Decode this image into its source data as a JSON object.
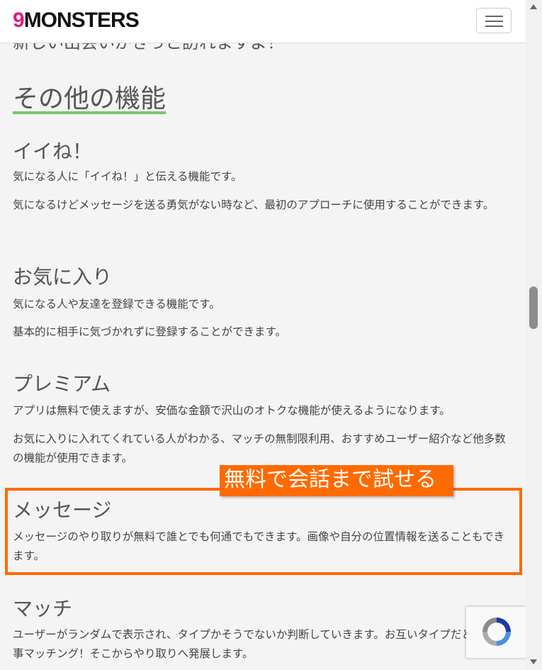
{
  "header": {
    "logo_nine": "9",
    "logo_text": "MONSTERS"
  },
  "partial_text": "新しい出会いがきっと訪れますよ！",
  "section": {
    "title": "その他の機能"
  },
  "features": [
    {
      "title": "イイね！",
      "desc": [
        "気になる人に「イイね！」と伝える機能です。",
        "気になるけどメッセージを送る勇気がない時など、最初のアプローチに使用することができます。"
      ]
    },
    {
      "title": "お気に入り",
      "desc": [
        "気になる人や友達を登録できる機能です。",
        "基本的に相手に気づかれずに登録することができます。"
      ]
    },
    {
      "title": "プレミアム",
      "desc": [
        "アプリは無料で使えますが、安価な金額で沢山のオトクな機能が使えるようになります。",
        "お気に入りに入れてくれている人がわかる、マッチの無制限利用、おすすめユーザー紹介など他多数の機能が使用できます。"
      ]
    },
    {
      "title": "メッセージ",
      "desc": [
        "メッセージのやり取りが無料で誰とでも何通でもできます。画像や自分の位置情報を送ることもできます。"
      ]
    },
    {
      "title": "マッチ",
      "desc": [
        "ユーザーがランダムで表示され、タイプかそうでないか判断していきます。お互いタイプだとすと見事マッチング！そこからやり取りへ発展します。"
      ]
    }
  ],
  "callout": "無料で会話まで試せる",
  "colors": {
    "accent": "#ff6a00",
    "underline": "#79c66b",
    "logo_pink": "#e0197d"
  },
  "icons": {
    "menu": "hamburger-icon",
    "recaptcha": "recaptcha-icon"
  }
}
